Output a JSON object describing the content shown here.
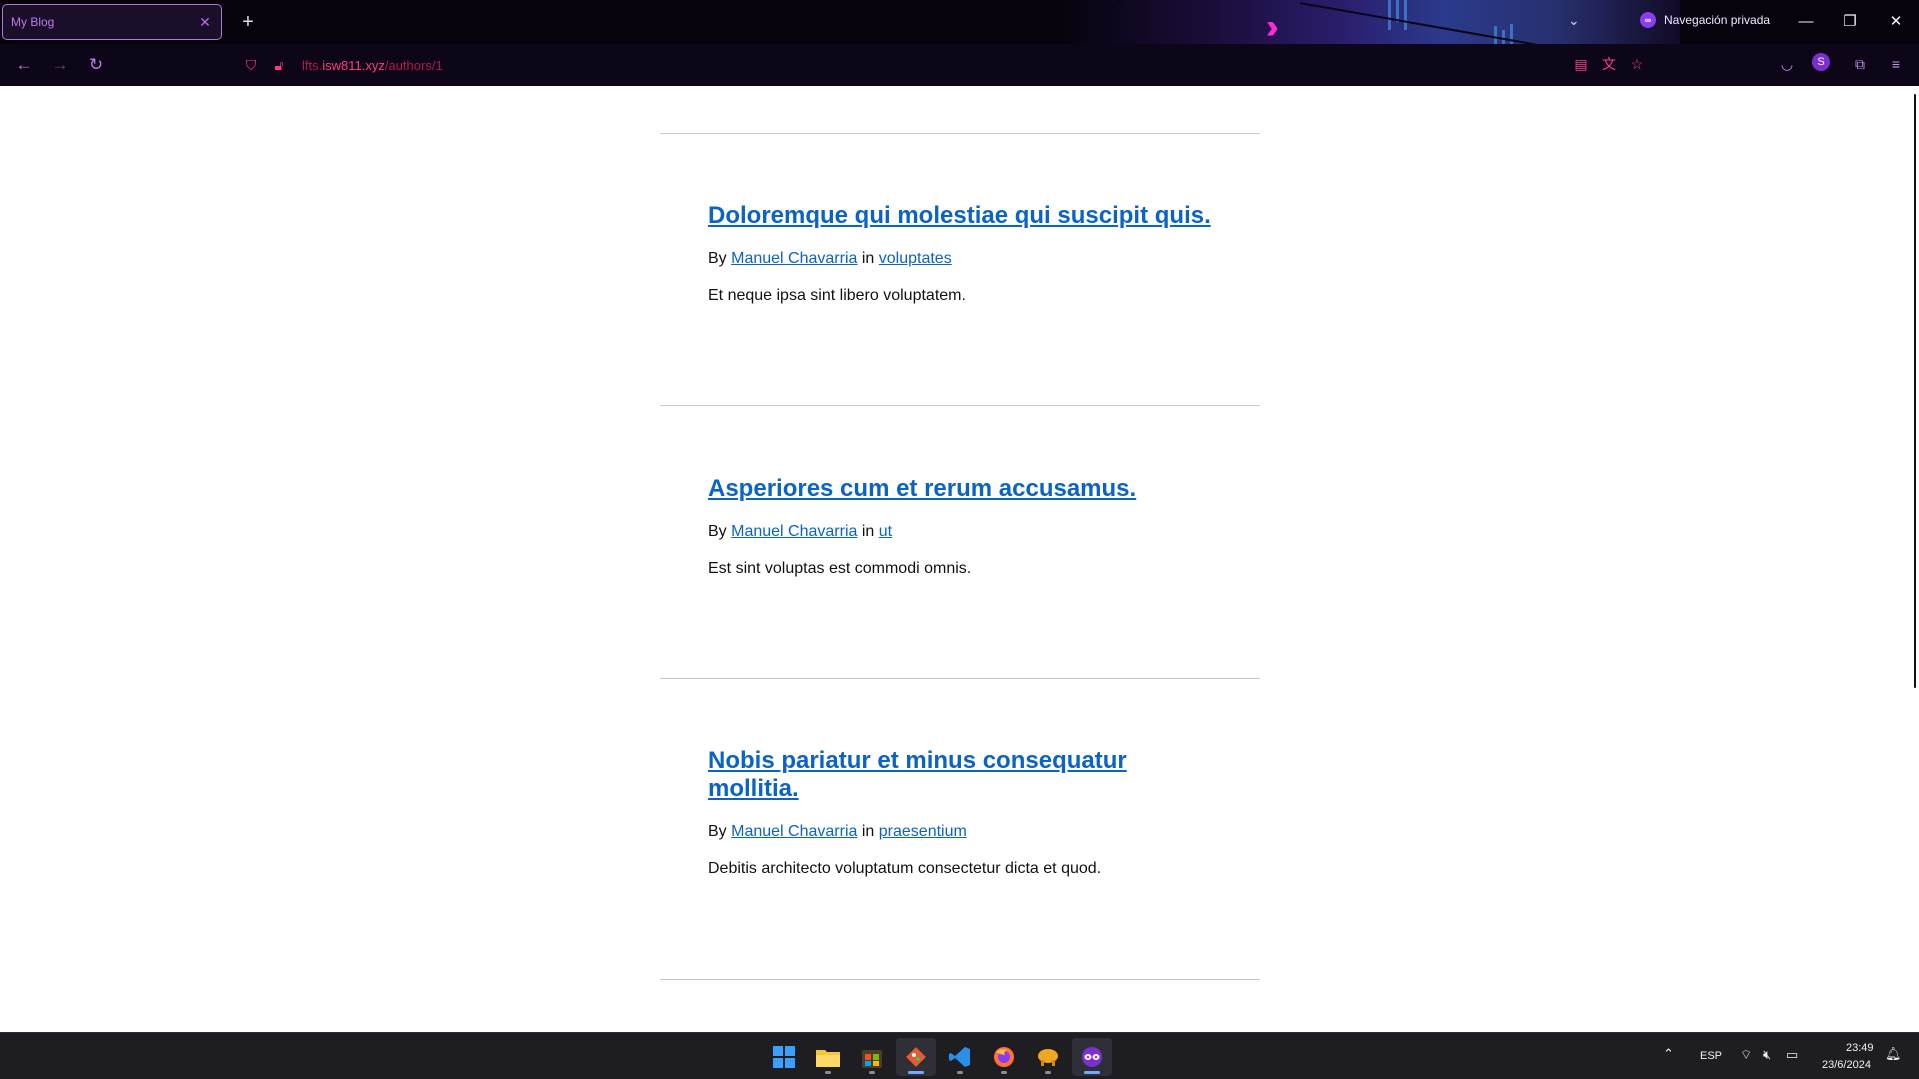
{
  "browser": {
    "tab_title": "My Blog",
    "tab_close": "✕",
    "new_tab": "+",
    "private_label": "Navegación privada",
    "private_icon": "∞",
    "url_prefix": "lfts.",
    "url_host": "isw811.xyz",
    "url_path": "/authors/1",
    "window_minimize": "—",
    "window_restore": "❐",
    "window_close": "✕",
    "list_tabs": "⌄",
    "profile_letter": "S"
  },
  "posts": [
    {
      "title": "Doloremque qui molestiae qui suscipit quis.",
      "by_label": "By",
      "author": "Manuel Chavarria",
      "in_label": "in",
      "category": "voluptates",
      "excerpt": "Et neque ipsa sint libero voluptatem."
    },
    {
      "title": "Asperiores cum et rerum accusamus.",
      "by_label": "By",
      "author": "Manuel Chavarria",
      "in_label": "in",
      "category": "ut",
      "excerpt": "Est sint voluptas est commodi omnis."
    },
    {
      "title_line1": "Nobis pariatur et minus consequatur",
      "title_line2": "mollitia.",
      "by_label": "By",
      "author": "Manuel Chavarria",
      "in_label": "in",
      "category": "praesentium",
      "excerpt": "Debitis architecto voluptatum consectetur dicta et quod."
    }
  ],
  "taskbar": {
    "language": "ESP",
    "time": "23:49",
    "date": "23/6/2024"
  },
  "colors": {
    "link": "#0b63c4",
    "chrome_accent": "#ff3d7f",
    "theme_accent": "#ff2bd6"
  },
  "icons": [
    "windows-start-icon",
    "file-explorer-icon",
    "app-store-icon",
    "git-icon",
    "vscode-icon",
    "firefox-icon",
    "tableplus-icon",
    "firefox-private-icon"
  ]
}
